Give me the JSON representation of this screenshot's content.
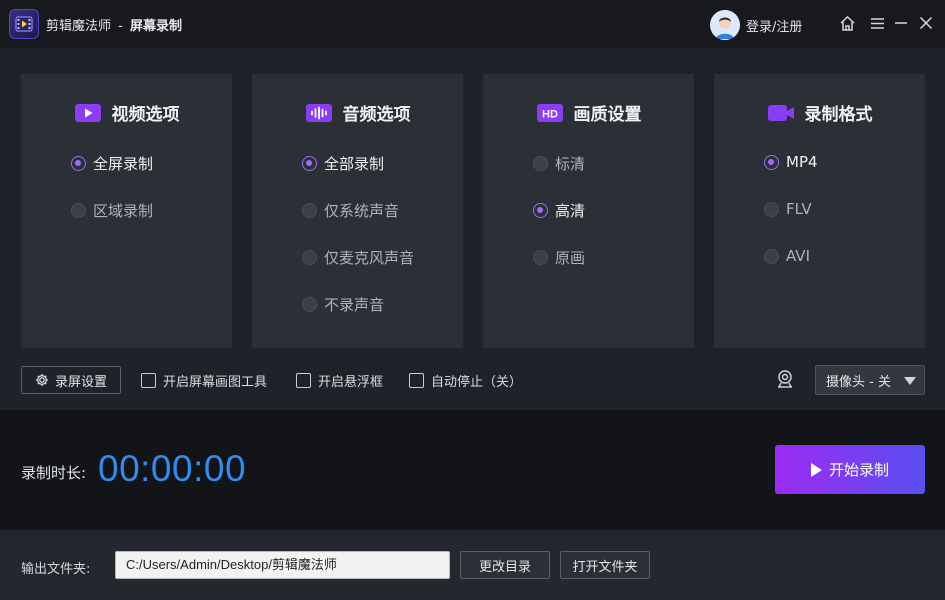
{
  "window": {
    "app_name": "剪辑魔法师",
    "separator": "-",
    "page_name": "屏幕录制",
    "login_label": "登录/注册"
  },
  "panels": [
    {
      "title": "视频选项",
      "icon": "video-icon",
      "options": [
        {
          "label": "全屏录制",
          "selected": true
        },
        {
          "label": "区域录制",
          "selected": false
        }
      ]
    },
    {
      "title": "音频选项",
      "icon": "audio-wave-icon",
      "options": [
        {
          "label": "全部录制",
          "selected": true
        },
        {
          "label": "仅系统声音",
          "selected": false
        },
        {
          "label": "仅麦克风声音",
          "selected": false
        },
        {
          "label": "不录声音",
          "selected": false
        }
      ]
    },
    {
      "title": "画质设置",
      "icon": "hd-icon",
      "icon_text": "HD",
      "options": [
        {
          "label": "标清",
          "selected": false
        },
        {
          "label": "高清",
          "selected": true
        },
        {
          "label": "原画",
          "selected": false
        }
      ]
    },
    {
      "title": "录制格式",
      "icon": "camera-format-icon",
      "options": [
        {
          "label": "MP4",
          "selected": true
        },
        {
          "label": "FLV",
          "selected": false
        },
        {
          "label": "AVI",
          "selected": false
        }
      ]
    }
  ],
  "toolbar": {
    "settings_label": "录屏设置",
    "checkboxes": [
      {
        "label": "开启屏幕画图工具",
        "checked": false
      },
      {
        "label": "开启悬浮框",
        "checked": false
      },
      {
        "label": "自动停止（关）",
        "checked": false
      }
    ],
    "camera_select": "摄像头 - 关"
  },
  "record": {
    "duration_label": "录制时长:",
    "timer": "00:00:00",
    "start_label": "开始录制"
  },
  "footer": {
    "output_label": "输出文件夹:",
    "output_path": "C:/Users/Admin/Desktop/剪辑魔法师",
    "change_dir_label": "更改目录",
    "open_folder_label": "打开文件夹"
  },
  "colors": {
    "accent": "#9d6df7",
    "timer": "#2f8cf0",
    "start_gradient_from": "#9b2bf2",
    "start_gradient_to": "#5a4ff0"
  }
}
